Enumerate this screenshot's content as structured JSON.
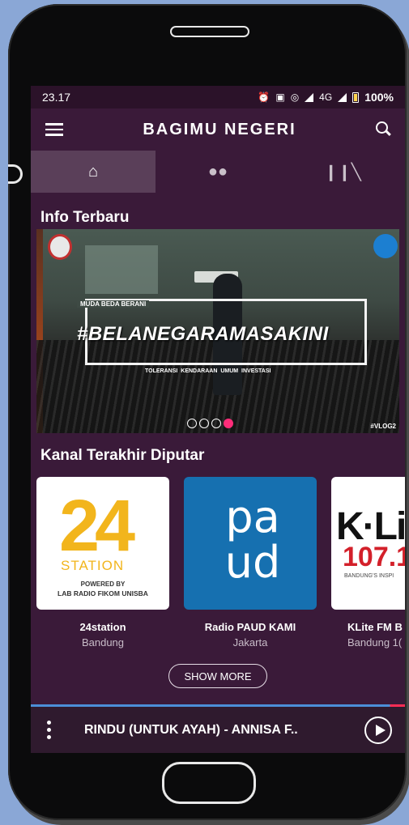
{
  "status_bar": {
    "time": "23.17",
    "network": "4G",
    "battery": "100%"
  },
  "app_bar": {
    "title": "BAGIMU NEGERI"
  },
  "tabs": [
    {
      "icon": "home-icon",
      "active": true
    },
    {
      "icon": "users-icon",
      "active": false
    },
    {
      "icon": "library-icon",
      "active": false
    }
  ],
  "info": {
    "title": "Info Terbaru",
    "banner": {
      "tagline_top": "MUDA BEDA BERANI",
      "hashtag": "#BELANEGARAMASAKINI",
      "tagline_bottom": "TOLERANSI   KENDARAAN UMUM   INVESTASI",
      "watermark": "#VLOG2",
      "slide_count": 4,
      "active_slide": 4
    }
  },
  "channels_section": {
    "title": "Kanal Terakhir Diputar",
    "items": [
      {
        "name": "24station",
        "city": "Bandung",
        "logo_number": "24",
        "logo_text": "STATION",
        "logo_powered": "POWERED BY",
        "logo_org": "LAB RADIO FIKOM UNISBA"
      },
      {
        "name": "Radio PAUD KAMI",
        "city": "Jakarta",
        "logo_line1": "pa",
        "logo_line2": "ud"
      },
      {
        "name": "KLite FM B",
        "city": "Bandung 1(",
        "logo_brand": "K·Li",
        "logo_freq": "107.1",
        "logo_sub": "BANDUNG'S INSPI"
      }
    ],
    "show_more": "SHOW MORE"
  },
  "player": {
    "track": "RINDU (UNTUK AYAH) - ANNISA F..",
    "progress": 0.96
  },
  "colors": {
    "background": "#3a1a39",
    "active_tab": "#5a3f59",
    "accent_pink": "#ff2d7a",
    "progress_blue": "#4b8fd8"
  }
}
